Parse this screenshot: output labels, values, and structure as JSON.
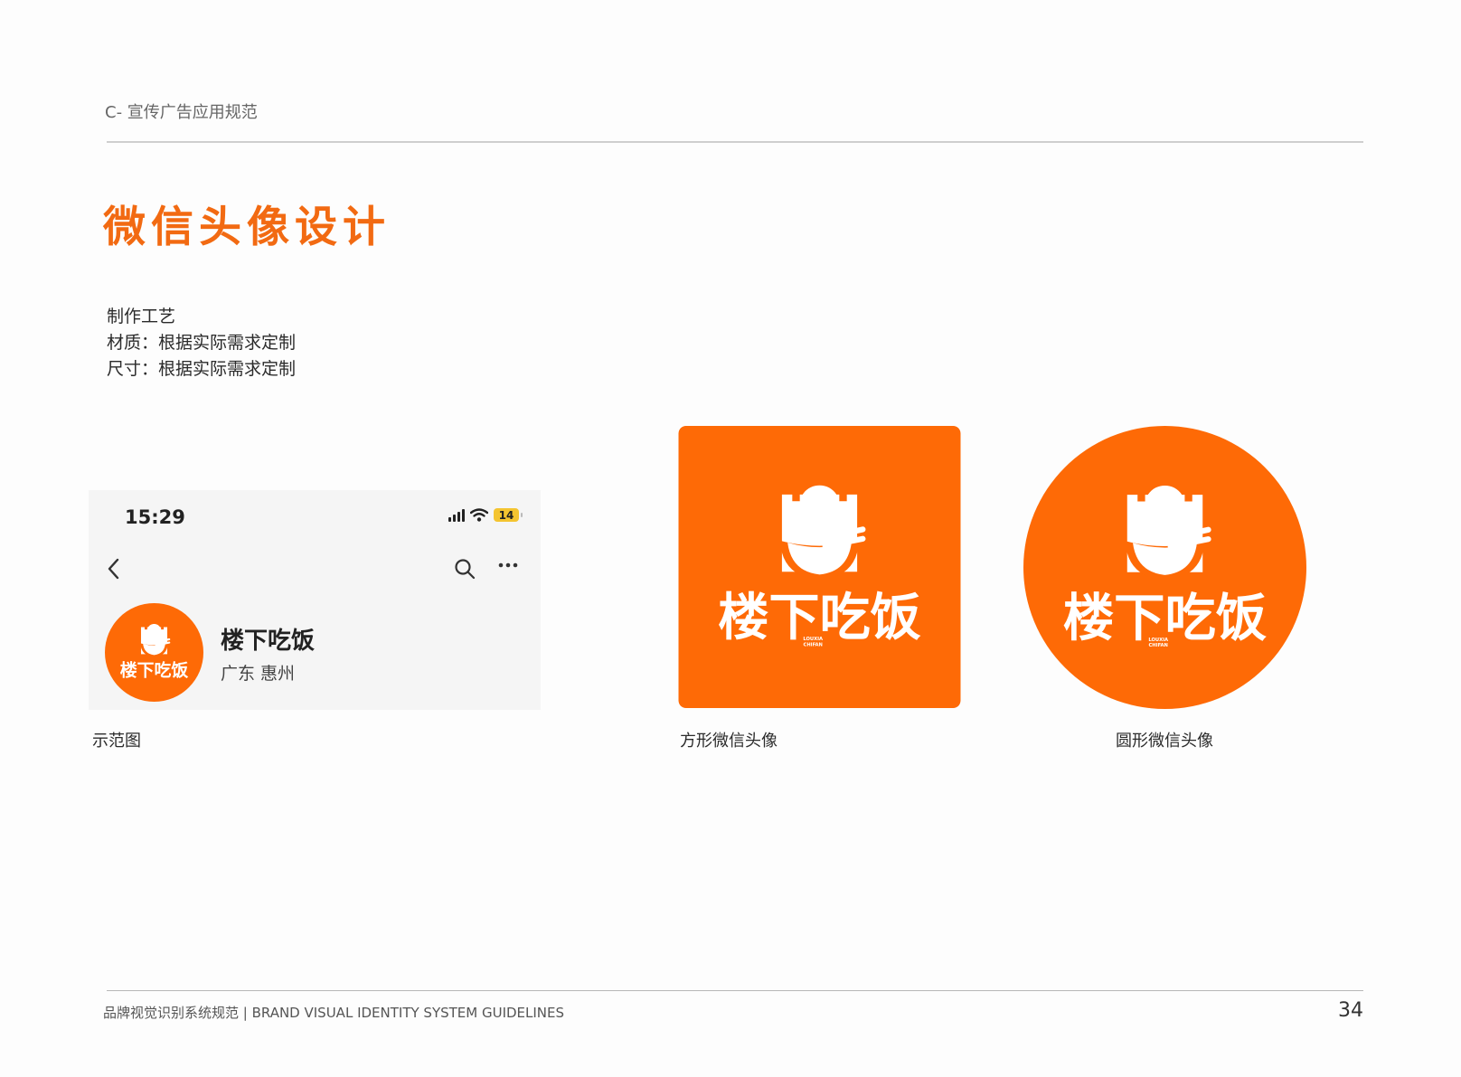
{
  "header": {
    "section": "C- 宣传广告应用规范",
    "title": "微信头像设计"
  },
  "spec": {
    "heading": "制作工艺",
    "material": "材质：根据实际需求定制",
    "size": "尺寸：根据实际需求定制"
  },
  "phone_mock": {
    "time": "15:29",
    "battery": "14",
    "profile_name": "楼下吃饭",
    "location": "广东  惠州"
  },
  "brand": {
    "logo_text": "楼下吃饭",
    "logo_subtext_line1": "LOUXIA",
    "logo_subtext_line2": "CHIFAN",
    "color_orange": "#fe6a06",
    "color_white": "#ffffff"
  },
  "captions": {
    "example": "示范图",
    "square": "方形微信头像",
    "circle": "圆形微信头像"
  },
  "footer": {
    "text": "品牌视觉识别系统规范 | BRAND VISUAL IDENTITY SYSTEM GUIDELINES",
    "page_number": "34"
  }
}
